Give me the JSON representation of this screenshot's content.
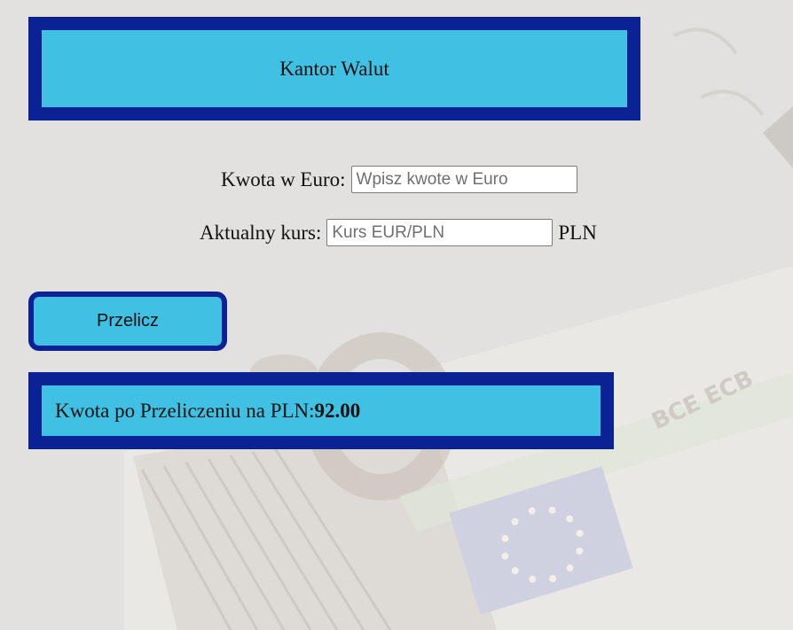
{
  "header": {
    "title": "Kantor Walut"
  },
  "form": {
    "euro_label": "Kwota w Euro:",
    "euro_value": "",
    "euro_placeholder": "Wpisz kwote w Euro",
    "rate_label": "Aktualny kurs:",
    "rate_value": "",
    "rate_placeholder": "Kurs EUR/PLN",
    "rate_unit": "PLN"
  },
  "button": {
    "label": "Przelicz"
  },
  "result": {
    "label": "Kwota po Przeliczeniu na PLN:",
    "value": "92.00"
  },
  "background": {
    "image_text": "BCE ECB"
  },
  "colors": {
    "page_bg": "#e2e1df",
    "border": "#0b2295",
    "panel": "#40c0e2",
    "text": "#111111"
  }
}
